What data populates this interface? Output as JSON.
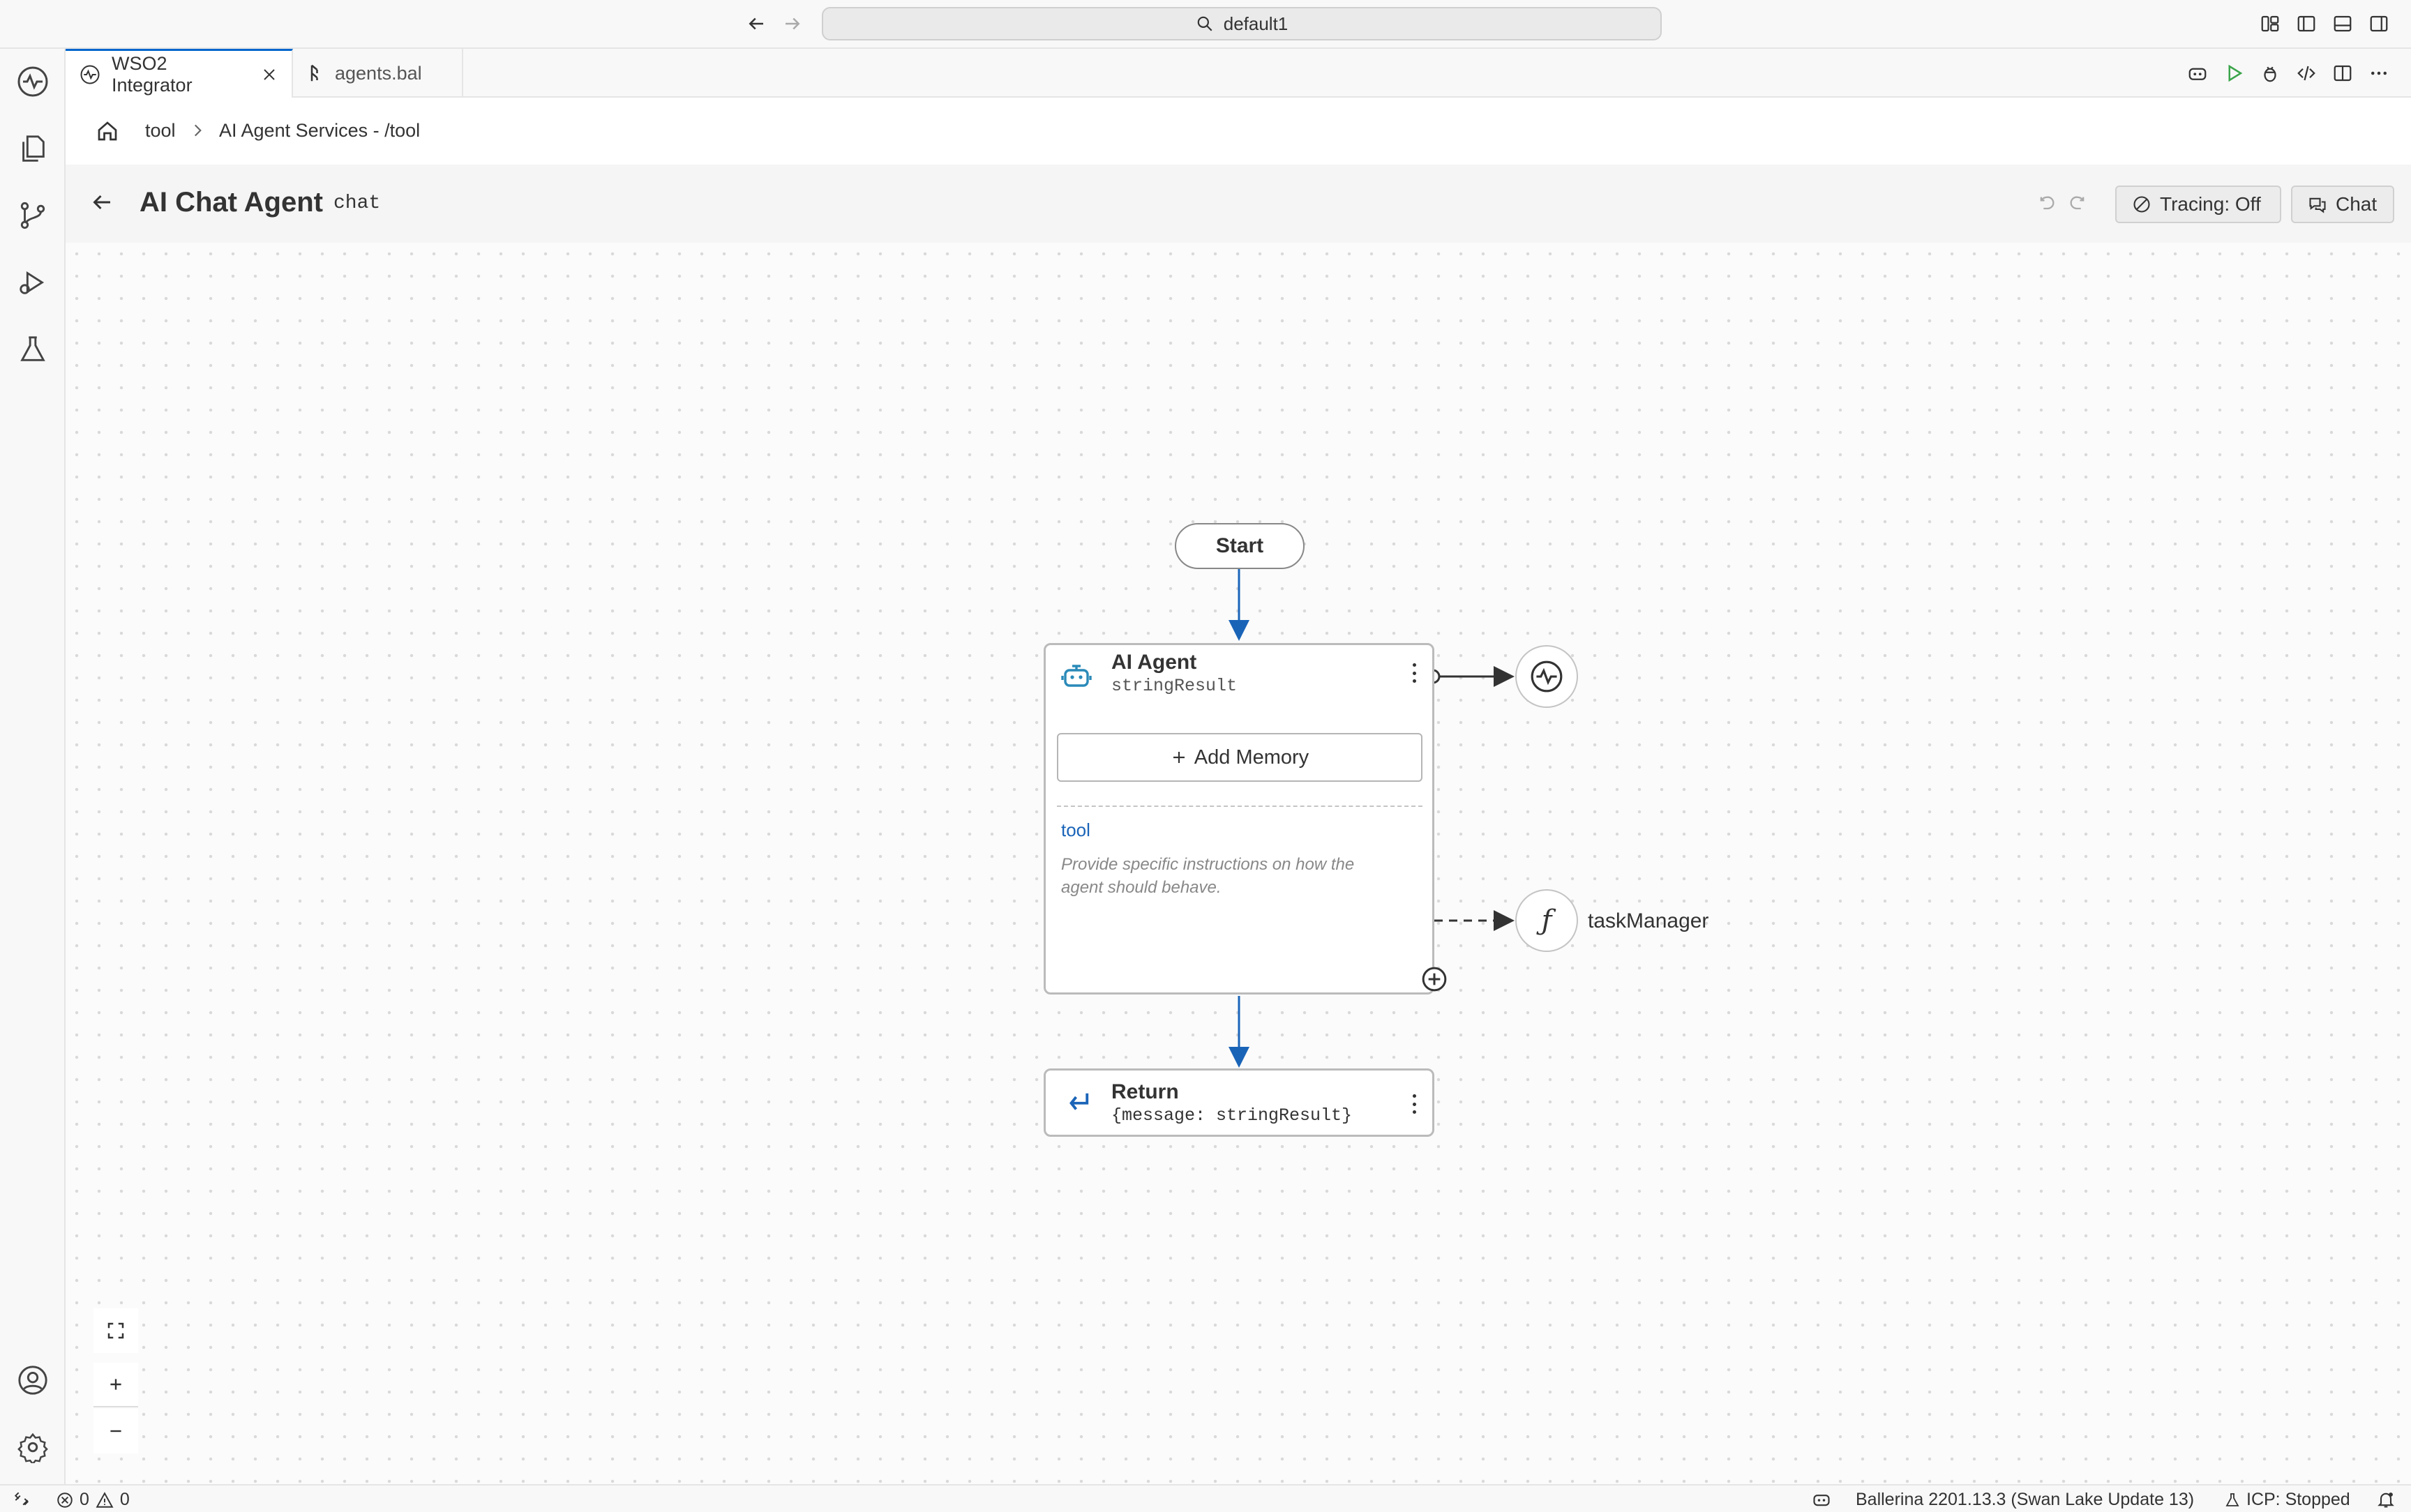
{
  "titlebar": {
    "search_text": "default1",
    "icons": [
      "back-arrow-icon",
      "forward-arrow-icon",
      "search-icon",
      "layout-icon",
      "toggle-sidebar-icon",
      "toggle-panel-icon",
      "toggle-secondary-sidebar-icon"
    ]
  },
  "activity_bar": {
    "items": [
      "wso2-integrator-icon",
      "explorer-icon",
      "source-control-icon",
      "run-debug-icon",
      "testing-icon"
    ],
    "bottom": [
      "accounts-icon",
      "settings-icon"
    ]
  },
  "tabs": [
    {
      "label": "WSO2 Integrator",
      "active": true,
      "closable": true,
      "icon": "wso2-icon"
    },
    {
      "label": "agents.bal",
      "active": false,
      "closable": false,
      "icon": "ballerina-file-icon"
    }
  ],
  "editor_actions": [
    "copilot-icon",
    "run-icon",
    "debug-icon",
    "code-icon",
    "split-editor-icon",
    "more-icon"
  ],
  "breadcrumb": {
    "home_icon": "home-icon",
    "items": [
      "tool",
      "AI Agent Services - /tool"
    ]
  },
  "header": {
    "title": "AI Chat Agent",
    "subtitle": "chat",
    "tracing_label": "Tracing: Off",
    "chat_label": "Chat"
  },
  "diagram": {
    "start_label": "Start",
    "agent": {
      "title": "AI Agent",
      "variable": "stringResult",
      "add_memory_label": "Add Memory",
      "tool_label": "tool",
      "instructions": "Provide specific instructions on how the agent should behave."
    },
    "model_node_icon": "model-provider-icon",
    "tool_node": {
      "label": "taskManager",
      "icon": "function-icon"
    },
    "return": {
      "title": "Return",
      "expression": "{message: stringResult}"
    },
    "edge_color": "#1a64b8"
  },
  "zoom_controls": [
    "fit-screen-icon",
    "zoom-in-icon",
    "zoom-out-icon"
  ],
  "statusbar": {
    "errors": "0",
    "warnings": "0",
    "ballerina_version": "Ballerina 2201.13.3 (Swan Lake Update 13)",
    "icp_status": "ICP: Stopped"
  }
}
